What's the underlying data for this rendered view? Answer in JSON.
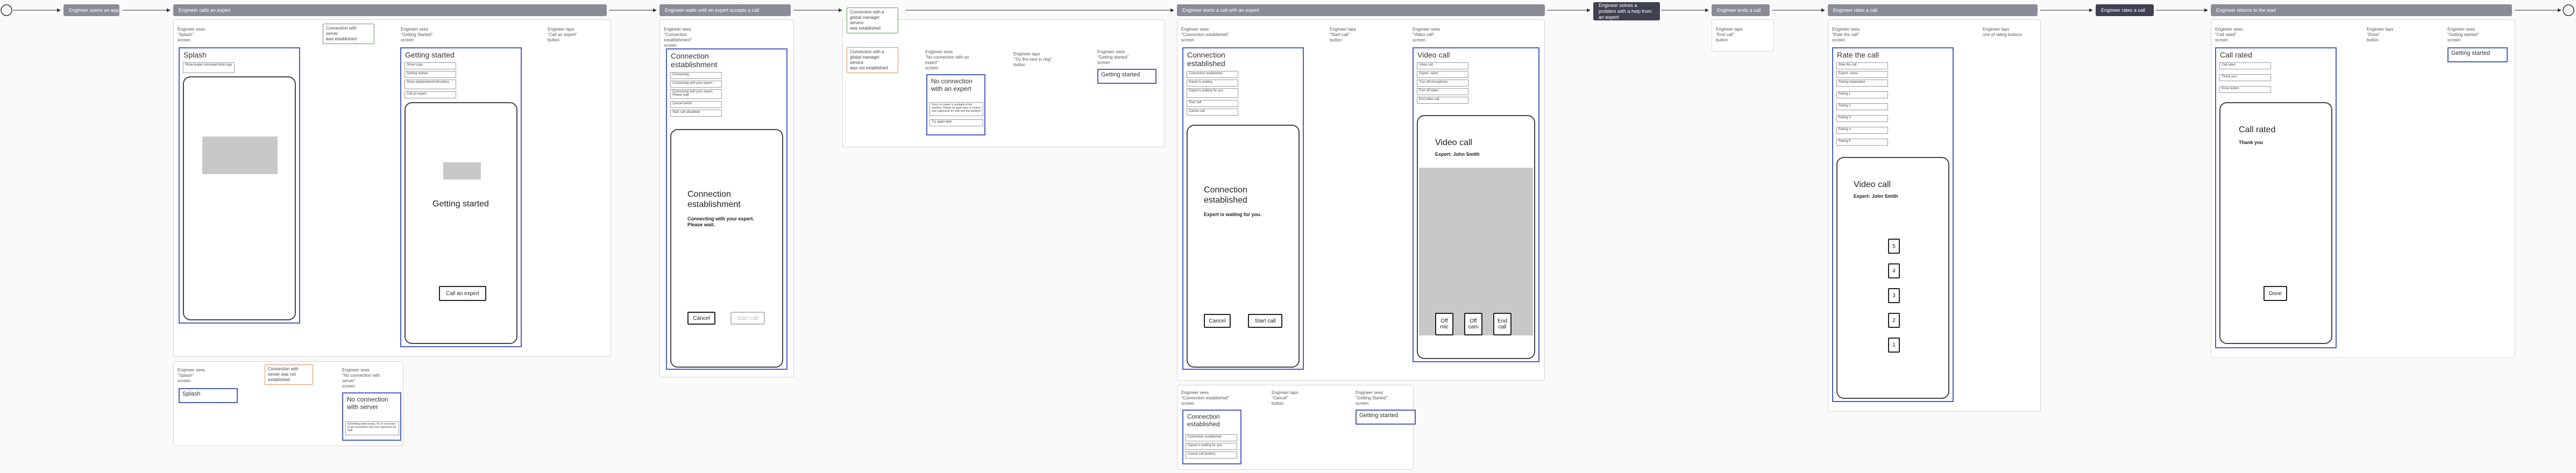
{
  "headers": {
    "h1": "Engineer opens an app",
    "h2": "Engineer calls an expert",
    "h3": "Engineer waits until an expert accepts a call",
    "h4": "Engineer starts a call with an expert",
    "h5": "Engineer solves a\nproblem with a help from\nan expert",
    "h6": "Engineer ends a call",
    "h7": "Engineer rates a call",
    "h8": "Engineer rates a call",
    "h9": "Engineer returns to the start"
  },
  "flow1": {
    "sees_splash": "Engineer sees\n\"Splash\"\nscreen",
    "cond_established": "Connection with\nserver\nwas established",
    "sees_getting_started": "Engineer sees\n\"Getting Started\"\nscreen",
    "taps_call": "Engineer taps\n\"Call an expert\"\nbutton",
    "splash_title": "Splash",
    "splash_field": "Show loader\nAnimated lottie logo",
    "gs_title": "Getting started",
    "gs_fields": [
      "Show Logo",
      "Getting started",
      "Show\nexplanation/instructions",
      "Call an expert"
    ],
    "gs_device_title": "Getting started",
    "gs_btn": "Call an expert"
  },
  "flow1b": {
    "sees_splash": "Engineer sees\n\"Splash\"\nscreen",
    "cond_not": "Connection with\nserver was not\nestablished",
    "sees_no_conn": "Engineer sees\n\"No connection with\nserver\"\nscreen",
    "splash_mini": "Splash",
    "no_conn_title": "No connection\nwith server",
    "no_conn_field": "Something went wrong. Try to\nreconnect to get connected. Ask\nyour supervisor for help."
  },
  "flow2": {
    "sees_conn": "Engineer sees\n\"Connection\nestablishment\"\nscreen",
    "title": "Connection\nestablishment",
    "fields": [
      "Connecting...",
      "Connecting with your expert",
      "Connecting with your\nexpert. Please wait",
      "Cancel button",
      "Start call (disabled)"
    ],
    "device_title": "Connection\nestablishment",
    "device_sub": "Connecting with your expert.\nPlease wait.",
    "btn_cancel": "Cancel",
    "btn_start": "Start call"
  },
  "flow3": {
    "cond_ok": "Connection with a\nglobal manager\nservice\nwas established",
    "cond_fail": "Connection with a\nglobal manager\nservice\nwas not established",
    "sees_no_expert": "Engineer sees\n\"No connection with an\nexpert\"\nscreen",
    "taps_try": "Engineer taps\n\"Try the next in ring\"\nbutton",
    "sees_gs": "Engineer sees\n\"Getting started\"\nscreen",
    "mini_title": "No connection\nwith an expert",
    "mini_field": "Sorry, no expert is available at the moment.\nPlease try again later or contact your supervisor\nfor help with this problem",
    "mini_btn": "Try again later",
    "gs_mini": "Getting started"
  },
  "flow4": {
    "sees_est": "Engineer sees\n\"Connection established\"\nscreen",
    "taps_start": "Engineer taps\n\"Start call\"\nbutton",
    "sees_video": "Engineer sees\n\"Video call\"\nscreen",
    "est_title": "Connection\nestablished",
    "est_fields": [
      "Connection established",
      "Expert is waiting",
      "Expert is waiting for you",
      "Start call",
      "Cancel call"
    ],
    "est_device_title": "Connection\nestablished",
    "est_device_sub": "Expert is waiting for you.",
    "btn_cancel": "Cancel",
    "btn_start": "Start call",
    "video_title": "Video call",
    "video_fields": [
      "Video call",
      "Expert: name",
      "Turn off microphone",
      "Turn off video",
      "End video call"
    ],
    "video_device_title": "Video call",
    "video_device_sub": "Expert: John Smith",
    "btn_mic": "Off\nmic",
    "btn_cam": "Off\ncam",
    "btn_end": "End\ncall"
  },
  "flow4b": {
    "sees_est": "Engineer sees\n\"Connection established\"\nscreen",
    "taps_cancel": "Engineer taps\n\"Cancel\"\nbutton",
    "sees_gs": "Engineer sees\n\"Getting Started\"\nscreen",
    "mini_title": "Connection\nestablished",
    "mini_fields": [
      "Connection established",
      "Expert is waiting for you",
      "Cancel call (button)"
    ],
    "gs_mini": "Getting started"
  },
  "flow5": {
    "taps_end": "Engineer taps\n\"End call\"\nbutton"
  },
  "flow6": {
    "sees_rate": "Engineer sees\n\"Rate the call\"\nscreen",
    "taps_rating": "Engineer taps\none of rating buttons",
    "rate_title": "Rate the call",
    "rate_fields": [
      "Rate the call",
      "Expert: name",
      "Rating explanation",
      "Rating 1",
      "Rating 2",
      "Rating 3",
      "Rating 4",
      "Rating 5"
    ],
    "device_title": "Video call",
    "device_sub": "Expert: John Smith",
    "ratings": [
      "5",
      "4",
      "3",
      "2",
      "1"
    ]
  },
  "flow7": {
    "sees_rated": "Engineer sees\n\"Call rated\"\nscreen",
    "taps_done": "Engineer taps\n\"Done\"\nbutton",
    "sees_gs": "Engineer sees\n\"Getting started\"\nscreen",
    "rated_title": "Call rated",
    "rated_fields": [
      "Call rated",
      "Thank you",
      "Done button"
    ],
    "device_title": "Call rated",
    "device_sub": "Thank you",
    "btn_done": "Done",
    "gs_mini": "Getting started"
  },
  "colors": {
    "accent": "#4a5fc4",
    "ok": "#5aa05a",
    "fail": "#e08a5a",
    "header": "#8a8d97",
    "header_dark": "#3f4150"
  }
}
